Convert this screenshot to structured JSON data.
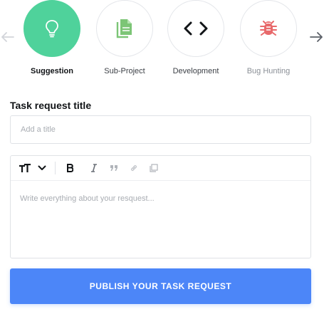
{
  "categories": [
    {
      "label": "Suggestion",
      "icon": "lightbulb-icon",
      "state": "active"
    },
    {
      "label": "Sub-Project",
      "icon": "document-icon",
      "state": "normal"
    },
    {
      "label": "Development",
      "icon": "code-icon",
      "state": "normal"
    },
    {
      "label": "Bug Hunting",
      "icon": "bug-icon",
      "state": "normal"
    }
  ],
  "nav": {
    "prev_icon": "arrow-left-icon",
    "next_icon": "arrow-right-icon"
  },
  "form": {
    "title_label": "Task request title",
    "title_placeholder": "Add a title",
    "body_placeholder": "Write everything about your resquest...",
    "toolbar": [
      "text-size-icon",
      "chevron-down-icon",
      "bold-icon",
      "italic-icon",
      "quote-icon",
      "link-icon",
      "image-icon"
    ],
    "submit_label": "PUBLISH YOUR TASK REQUEST"
  },
  "colors": {
    "accent_green": "#4fd29b",
    "primary_blue": "#4c86f8",
    "doc_green": "#7cc576",
    "bug_red": "#e8696b"
  }
}
